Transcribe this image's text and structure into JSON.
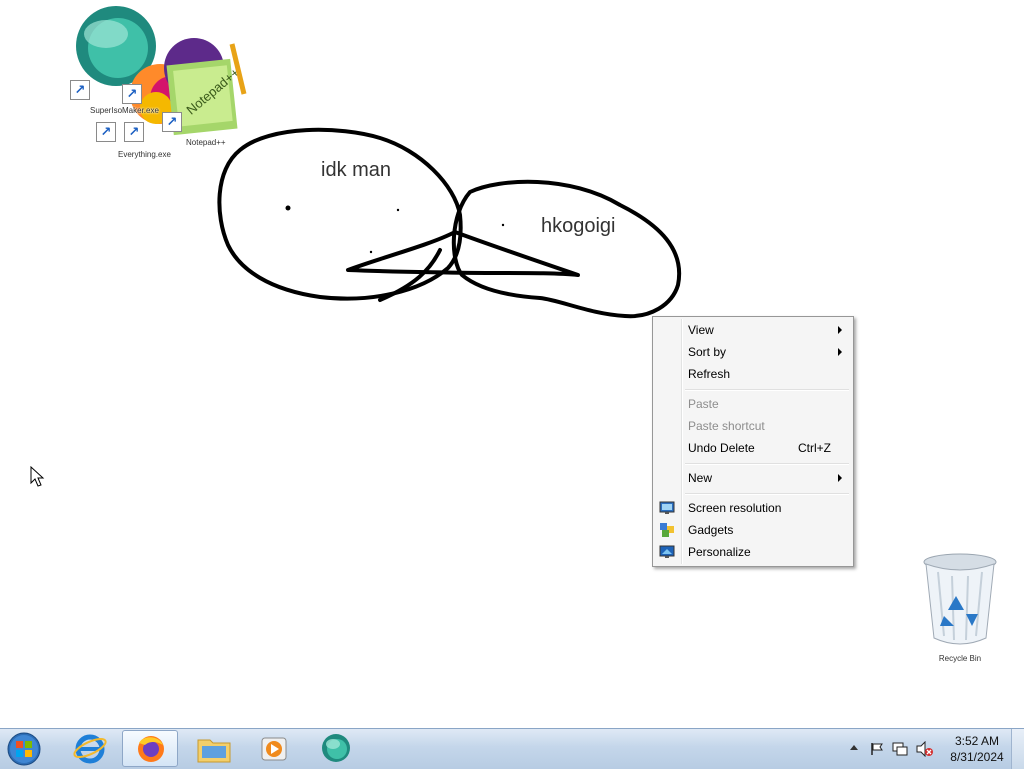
{
  "desktop": {
    "scribble_texts": [
      "idk man",
      "hkogoigi"
    ],
    "icons": [
      {
        "name": "super-iso-maker-shortcut",
        "label": "SuperIsoMaker.exe"
      },
      {
        "name": "app-shortcut",
        "label": "Everything.exe"
      },
      {
        "name": "notepad-plus-plus-shortcut",
        "label": "Notepad++"
      }
    ],
    "recycle_bin_label": "Recycle Bin"
  },
  "context_menu": {
    "items": [
      {
        "label": "View",
        "submenu": true
      },
      {
        "label": "Sort by",
        "submenu": true
      },
      {
        "label": "Refresh"
      },
      {
        "label": "Paste",
        "disabled": true
      },
      {
        "label": "Paste shortcut",
        "disabled": true
      },
      {
        "label": "Undo Delete",
        "shortcut": "Ctrl+Z"
      },
      {
        "label": "New",
        "submenu": true
      },
      {
        "label": "Screen resolution",
        "icon": "monitor-icon"
      },
      {
        "label": "Gadgets",
        "icon": "gadgets-icon"
      },
      {
        "label": "Personalize",
        "icon": "personalize-icon"
      }
    ]
  },
  "taskbar": {
    "items": [
      "start-orb",
      "internet-explorer",
      "firefox",
      "file-explorer",
      "media-player",
      "app"
    ],
    "active_item": "firefox"
  },
  "tray": {
    "time": "3:52 AM",
    "date": "8/31/2024"
  }
}
